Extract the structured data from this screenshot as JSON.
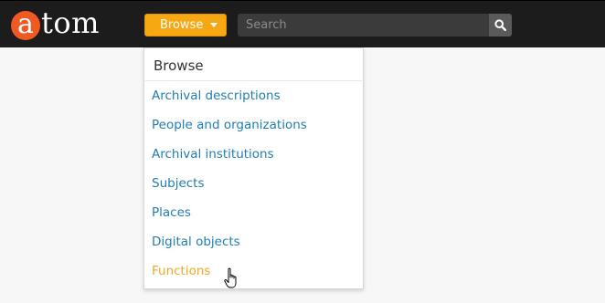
{
  "app": {
    "logo_letter": "a",
    "logo_rest": "tom"
  },
  "header": {
    "browse_label": "Browse",
    "search_placeholder": "Search"
  },
  "dropdown": {
    "title": "Browse",
    "items": [
      {
        "label": "Archival descriptions"
      },
      {
        "label": "People and organizations"
      },
      {
        "label": "Archival institutions"
      },
      {
        "label": "Subjects"
      },
      {
        "label": "Places"
      },
      {
        "label": "Digital objects"
      },
      {
        "label": "Functions"
      }
    ]
  },
  "colors": {
    "topbar_bg": "#1c1c1c",
    "accent_orange": "#f6a813",
    "logo_orange": "#ef5a23",
    "link_blue": "#1f7db5",
    "hover_orange": "#f2aa20"
  }
}
